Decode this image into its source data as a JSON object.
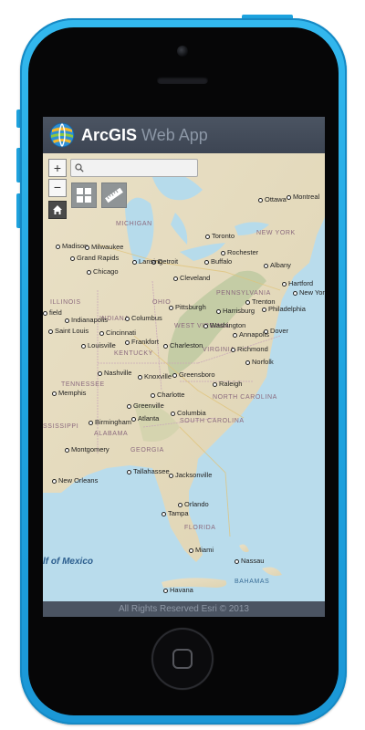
{
  "app": {
    "title_brand": "ArcGIS",
    "title_rest": "Web App",
    "footer": "All Rights Reserved Esri © 2013"
  },
  "controls": {
    "zoom_in": "+",
    "zoom_out": "−",
    "search_value": "",
    "search_icon": "search-icon",
    "home_icon": "home-icon",
    "basemap_icon": "basemap-gallery-icon",
    "measure_icon": "ruler-icon"
  },
  "colors": {
    "header": "#4b5462",
    "phone_body": "#1ea3df",
    "water": "#b8dcec",
    "land": "#e6dcc0"
  },
  "map": {
    "cities": {
      "ottawa": "Ottawa",
      "montreal": "Montreal",
      "toronto": "Toronto",
      "rochester": "Rochester",
      "buffalo": "Buffalo",
      "albany": "Albany",
      "detroit": "Detroit",
      "lansing": "Lansing",
      "cleveland": "Cleveland",
      "madison": "Madison",
      "milwaukee": "Milwaukee",
      "grand_rapids": "Grand Rapids",
      "chicago": "Chicago",
      "hartford": "Hartford",
      "new_york": "New York",
      "trenton": "Trenton",
      "harrisburg": "Harrisburg",
      "philadelphia": "Philadelphia",
      "pittsburgh": "Pittsburgh",
      "columbus": "Columbus",
      "indianapolis": "Indianapolis",
      "cincinnati": "Cincinnati",
      "frankfort": "Frankfort",
      "louisville": "Louisville",
      "saint_louis": "Saint Louis",
      "springfield": "field",
      "charleston": "Charleston",
      "washington": "Washington",
      "annapolis": "Annapolis",
      "dover": "Dover",
      "richmond": "Richmond",
      "norfolk": "Norfolk",
      "nashville": "Nashville",
      "knoxville": "Knoxville",
      "greensboro": "Greensboro",
      "raleigh": "Raleigh",
      "memphis": "Memphis",
      "charlotte": "Charlotte",
      "greenville": "Greenville",
      "atlanta": "Atlanta",
      "columbia": "Columbia",
      "birmingham": "Birmingham",
      "montgomery": "Montgomery",
      "tallahassee": "Tallahassee",
      "jacksonville": "Jacksonville",
      "new_orleans": "New Orleans",
      "orlando": "Orlando",
      "tampa": "Tampa",
      "miami": "Miami",
      "nassau": "Nassau",
      "havana": "Havana"
    },
    "states": {
      "new_york": "NEW YORK",
      "michigan": "MICHIGAN",
      "pennsylvania": "PENNSYLVANIA",
      "illinois": "ILLINOIS",
      "ohio": "OHIO",
      "indiana": "INDIANA",
      "west_virginia": "WEST VIRGINIA",
      "virginia": "VIRGINIA",
      "kentucky": "KENTUCKY",
      "tennessee": "TENNESSEE",
      "north_carolina": "NORTH CAROLINA",
      "south_carolina": "SOUTH CAROLINA",
      "alabama": "ALABAMA",
      "georgia": "GEORGIA",
      "mississippi": "SSISSIPPI",
      "florida": "FLORIDA",
      "bahamas": "BAHAMAS"
    },
    "gulf": "lf of Mexico"
  }
}
